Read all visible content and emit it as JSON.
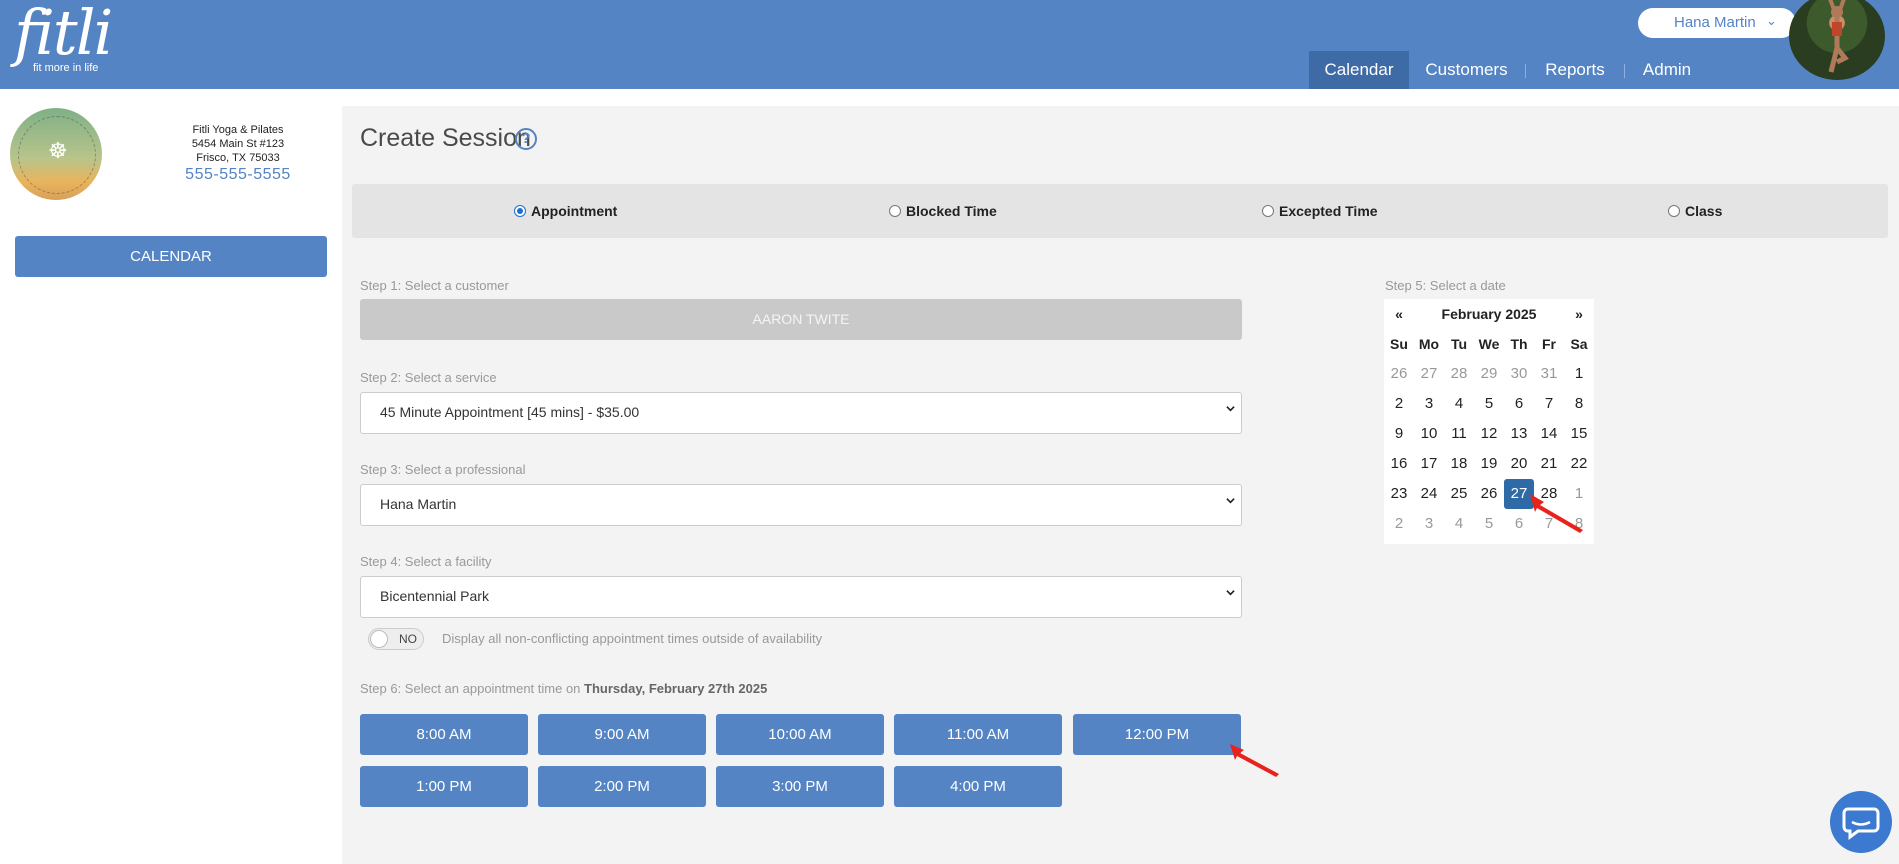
{
  "brand": {
    "word": "fitli",
    "tagline": "fit more in life"
  },
  "user": {
    "name": "Hana Martin"
  },
  "nav": [
    {
      "label": "Calendar",
      "active": true
    },
    {
      "label": "Customers",
      "active": false
    },
    {
      "label": "Reports",
      "active": false
    },
    {
      "label": "Admin",
      "active": false
    }
  ],
  "business": {
    "name": "Fitli Yoga & Pilates",
    "address1": "5454 Main St #123",
    "address2": "Frisco, TX 75033",
    "phone": "555-555-5555",
    "logo_text": "FITLI YOGA & PILATES"
  },
  "sidebar": {
    "calendar_button": "CALENDAR"
  },
  "page": {
    "title": "Create Session",
    "help_icon": "?"
  },
  "session_types": [
    {
      "label": "Appointment",
      "selected": true
    },
    {
      "label": "Blocked Time",
      "selected": false
    },
    {
      "label": "Excepted Time",
      "selected": false
    },
    {
      "label": "Class",
      "selected": false
    }
  ],
  "steps": {
    "customer_label": "Step 1: Select a customer",
    "customer_value": "AARON TWITE",
    "service_label": "Step 2: Select a service",
    "service_value": "45 Minute Appointment [45 mins] - $35.00",
    "professional_label": "Step 3: Select a professional",
    "professional_value": "Hana Martin",
    "facility_label": "Step 4: Select a facility",
    "facility_value": "Bicentennial Park",
    "toggle_state": "NO",
    "toggle_desc": "Display all non-conflicting appointment times outside of availability",
    "time_label_prefix": "Step 6: Select an appointment time on",
    "time_label_date": "Thursday, February 27th 2025",
    "date_label": "Step 5: Select a date"
  },
  "time_slots": [
    "8:00 AM",
    "9:00 AM",
    "10:00 AM",
    "11:00 AM",
    "12:00 PM",
    "1:00 PM",
    "2:00 PM",
    "3:00 PM",
    "4:00 PM"
  ],
  "calendar": {
    "prev": "«",
    "next": "»",
    "month_label": "February 2025",
    "weekdays": [
      "Su",
      "Mo",
      "Tu",
      "We",
      "Th",
      "Fr",
      "Sa"
    ],
    "weeks": [
      [
        "26",
        "27",
        "28",
        "29",
        "30",
        "31",
        "1"
      ],
      [
        "2",
        "3",
        "4",
        "5",
        "6",
        "7",
        "8"
      ],
      [
        "9",
        "10",
        "11",
        "12",
        "13",
        "14",
        "15"
      ],
      [
        "16",
        "17",
        "18",
        "19",
        "20",
        "21",
        "22"
      ],
      [
        "23",
        "24",
        "25",
        "26",
        "27",
        "28",
        "1"
      ],
      [
        "2",
        "3",
        "4",
        "5",
        "6",
        "7",
        "8"
      ]
    ],
    "selected": "27",
    "colors": {
      "selected_bg": "#2e6aa6"
    }
  },
  "colors": {
    "brand": "#5484c4",
    "nav_active": "#3e6aa6",
    "annotation_arrow": "#e8231c"
  },
  "icons": {
    "chat": "chat-bubble-icon",
    "help": "question-circle-icon",
    "caret": "chevron-down-icon"
  }
}
